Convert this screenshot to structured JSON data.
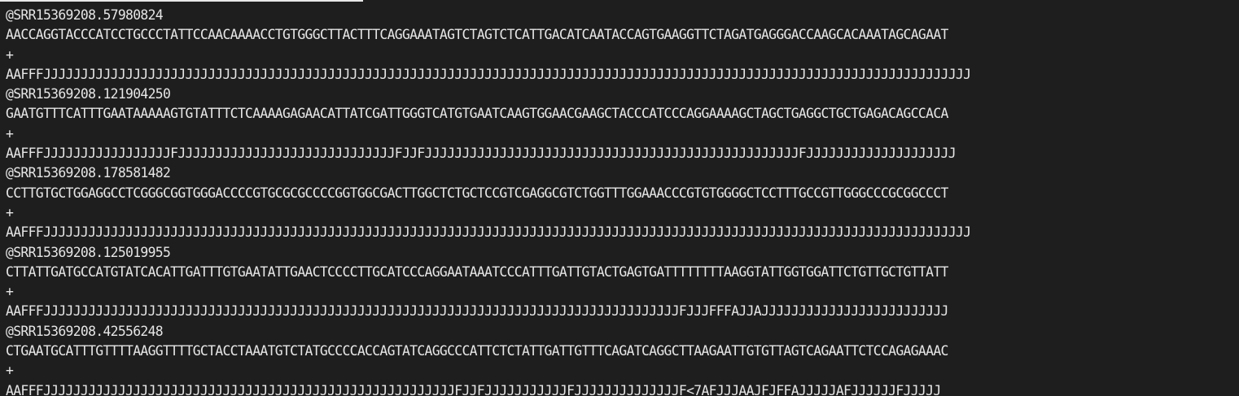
{
  "terminal": {
    "records": [
      {
        "header": "@SRR15369208.57980824",
        "sequence": "AACCAGGTACCCATCCTGCCCTATTCCAACAAAACCTGTGGGCTTACTTTCAGGAAATAGTCTAGTCTCATTGACATCAATACCAGTGAAGGTTCTAGATGAGGGACCAAGCACAAATAGCAGAAT",
        "separator": "+",
        "quality": "AAFFFJJJJJJJJJJJJJJJJJJJJJJJJJJJJJJJJJJJJJJJJJJJJJJJJJJJJJJJJJJJJJJJJJJJJJJJJJJJJJJJJJJJJJJJJJJJJJJJJJJJJJJJJJJJJJJJJJJJJJJJJJJJJ"
      },
      {
        "header": "@SRR15369208.121904250",
        "sequence": "GAATGTTTCATTTGAATAAAAAGTGTATTTCTCAAAAGAGAACATTATCGATTGGGTCATGTGAATCAAGTGGAACGAAGCTACCCATCCCAGGAAAAGCTAGCTGAGGCTGCTGAGACAGCCACA",
        "separator": "+",
        "quality": "AAFFFJJJJJJJJJJJJJJJJJFJJJJJJJJJJJJJJJJJJJJJJJJJJJJJFJJFJJJJJJJJJJJJJJJJJJJJJJJJJJJJJJJJJJJJJJJJJJJJJJJJJJFJJJJJJJJJJJJJJJJJJJJ"
      },
      {
        "header": "@SRR15369208.178581482",
        "sequence": "CCTTGTGCTGGAGGCCTCGGGCGGTGGGACCCCGTGCGCGCCCCGGTGGCGACTTGGCTCTGCTCCGTCGAGGCGTCTGGTTTGGAAACCCGTGTGGGGCTCCTTTGCCGTTGGGCCCGCGGCCCT",
        "separator": "+",
        "quality": "AAFFFJJJJJJJJJJJJJJJJJJJJJJJJJJJJJJJJJJJJJJJJJJJJJJJJJJJJJJJJJJJJJJJJJJJJJJJJJJJJJJJJJJJJJJJJJJJJJJJJJJJJJJJJJJJJJJJJJJJJJJJJJJJJ"
      },
      {
        "header": "@SRR15369208.125019955",
        "sequence": "CTTATTGATGCCATGTATCACATTGATTTGTGAATATTGAACTCCCCTTGCATCCCAGGAATAAATCCCATTTGATTGTACTGAGTGATTTTTTTTAAGGTATTGGTGGATTCTGTTGCTGTTATT",
        "separator": "+",
        "quality": "AAFFFJJJJJJJJJJJJJJJJJJJJJJJJJJJJJJJJJJJJJJJJJJJJJJJJJJJJJJJJJJJJJJJJJJJJJJJJJJJJJJJJJJJJJFJJJFFFAJJAJJJJJJJJJJJJJJJJJJJJJJJJJ"
      },
      {
        "header": "@SRR15369208.42556248",
        "sequence": "CTGAATGCATTTGTTTTAAGGTTTTGCTACCTAAATGTCTATGCCCCACCAGTATCAGGCCCATTCTCTATTGATTGTTTCAGATCAGGCTTAAGAATTGTGTTAGTCAGAATTCTCCAGAGAAAC",
        "separator": "+",
        "quality": "AAFFFJJJJJJJJJJJJJJJJJJJJJJJJJJJJJJJJJJJJJJJJJJJJJJJJJJJJJJJFJJFJJJJJJJJJJJFJJJJJJJJJJJJJJF<7AFJJJAAJFJFFAJJJJJAFJJJJJJFJJJJJ"
      }
    ]
  }
}
